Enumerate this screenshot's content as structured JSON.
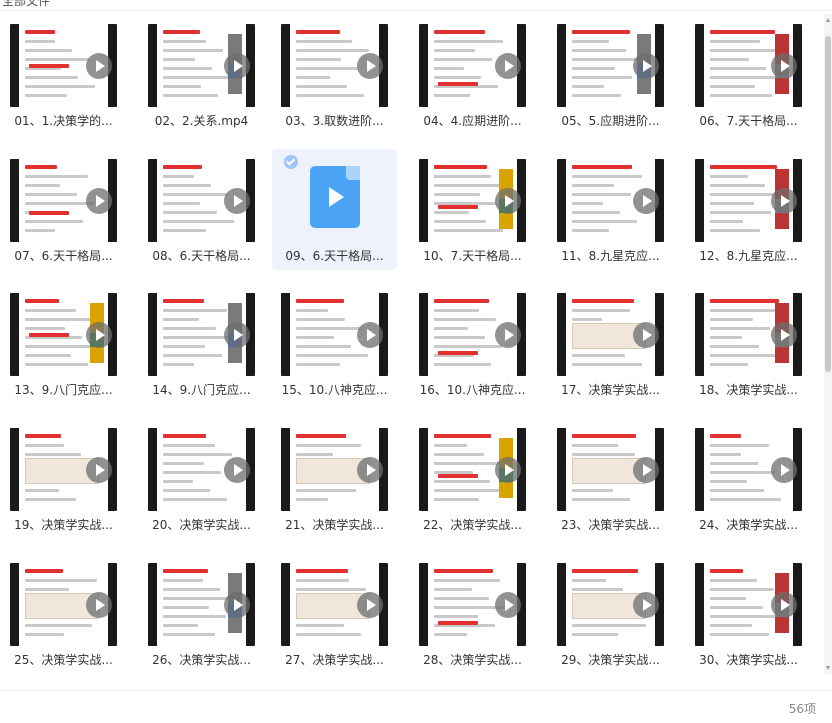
{
  "header": {
    "breadcrumb": "全部文件"
  },
  "files": [
    {
      "label": "01、1.决策学的..."
    },
    {
      "label": "02、2.关系.mp4"
    },
    {
      "label": "03、3.取数进阶..."
    },
    {
      "label": "04、4.应期进阶..."
    },
    {
      "label": "05、5.应期进阶..."
    },
    {
      "label": "06、7.天干格局..."
    },
    {
      "label": "07、6.天干格局..."
    },
    {
      "label": "08、6.天干格局..."
    },
    {
      "label": "09、6.天干格局...",
      "selected": true,
      "generic_icon": true
    },
    {
      "label": "10、7.天干格局..."
    },
    {
      "label": "11、8.九星克应..."
    },
    {
      "label": "12、8.九星克应..."
    },
    {
      "label": "13、9.八门克应..."
    },
    {
      "label": "14、9.八门克应..."
    },
    {
      "label": "15、10.八神克应..."
    },
    {
      "label": "16、10.八神克应..."
    },
    {
      "label": "17、决策学实战..."
    },
    {
      "label": "18、决策学实战..."
    },
    {
      "label": "19、决策学实战..."
    },
    {
      "label": "20、决策学实战..."
    },
    {
      "label": "21、决策学实战..."
    },
    {
      "label": "22、决策学实战..."
    },
    {
      "label": "23、决策学实战..."
    },
    {
      "label": "24、决策学实战..."
    },
    {
      "label": "25、决策学实战..."
    },
    {
      "label": "26、决策学实战..."
    },
    {
      "label": "27、决策学实战..."
    },
    {
      "label": "28、决策学实战..."
    },
    {
      "label": "29、决策学实战..."
    },
    {
      "label": "30、决策学实战..."
    }
  ],
  "icons": {
    "play": "play-icon",
    "video_file": "video-file-icon",
    "check": "check-icon"
  },
  "colors": {
    "accent": "#4aa3f5",
    "selected_bg": "#eef3fb",
    "red_mark": "#e03030"
  },
  "footer": {
    "count": "56项"
  }
}
